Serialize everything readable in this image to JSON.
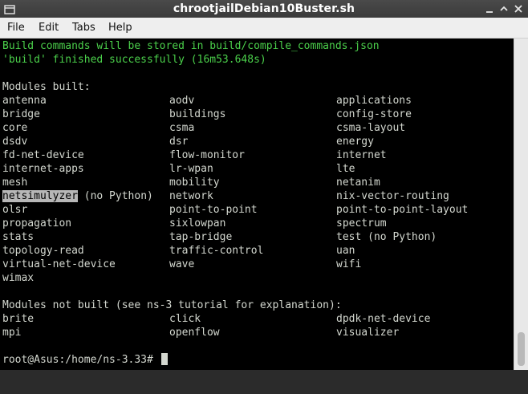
{
  "window": {
    "title": "chrootjailDebian10Buster.sh"
  },
  "menu": {
    "file": "File",
    "edit": "Edit",
    "tabs": "Tabs",
    "help": "Help"
  },
  "terminal": {
    "build_msg_1": "Build commands will be stored in build/compile_commands.json",
    "build_msg_2": "'build' finished successfully (16m53.648s)",
    "modules_built_header": "Modules built:",
    "built_rows": [
      [
        "antenna",
        "aodv",
        "applications"
      ],
      [
        "bridge",
        "buildings",
        "config-store"
      ],
      [
        "core",
        "csma",
        "csma-layout"
      ],
      [
        "dsdv",
        "dsr",
        "energy"
      ],
      [
        "fd-net-device",
        "flow-monitor",
        "internet"
      ],
      [
        "internet-apps",
        "lr-wpan",
        "lte"
      ],
      [
        "mesh",
        "mobility",
        "netanim"
      ],
      [
        "netsimulyzer",
        "network",
        "nix-vector-routing"
      ],
      [
        "olsr",
        "point-to-point",
        "point-to-point-layout"
      ],
      [
        "propagation",
        "sixlowpan",
        "spectrum"
      ],
      [
        "stats",
        "tap-bridge",
        "test (no Python)"
      ],
      [
        "topology-read",
        "traffic-control",
        "uan"
      ],
      [
        "virtual-net-device",
        "wave",
        "wifi"
      ],
      [
        "wimax",
        "",
        ""
      ]
    ],
    "netsimulyzer_suffix": " (no Python)",
    "modules_not_built_header": "Modules not built (see ns-3 tutorial for explanation):",
    "not_built_rows": [
      [
        "brite",
        "click",
        "dpdk-net-device"
      ],
      [
        "mpi",
        "openflow",
        "visualizer"
      ]
    ],
    "prompt": "root@Asus:/home/ns-3.33# "
  },
  "colors": {
    "terminal_bg": "#000000",
    "terminal_fg": "#d3d7cf",
    "success_green": "#4bd04b",
    "selection_bg": "#b7b7b7"
  }
}
